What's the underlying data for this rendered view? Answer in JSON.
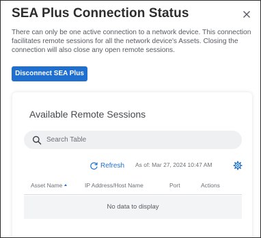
{
  "dialog": {
    "title": "SEA Plus Connection Status",
    "description": "There can only be one active connection to a network device. This connection facilitates remote sessions for all the network device's Assets. Closing the connection will also close any open remote sessions.",
    "disconnect_label": "Disconnect SEA Plus",
    "close_icon": "close-icon"
  },
  "sessions_panel": {
    "title": "Available Remote Sessions",
    "search": {
      "placeholder": "Search Table",
      "value": "",
      "icon": "search-icon"
    },
    "refresh_label": "Refresh",
    "as_of": "As of: Mar 27, 2024 10:47 AM",
    "settings_icon": "gear-icon",
    "table": {
      "columns": [
        "Asset Name",
        "IP Address/Host Name",
        "Port",
        "Actions"
      ],
      "sorted_column": "Asset Name",
      "sort_direction": "ascending",
      "rows": [],
      "empty_message": "No data to display"
    }
  },
  "colors": {
    "accent": "#1f6fd1",
    "title_text": "#2d2d2d",
    "body_text": "#555b62",
    "search_bg": "#eef0f2",
    "empty_row_bg": "#f3f4f5"
  }
}
